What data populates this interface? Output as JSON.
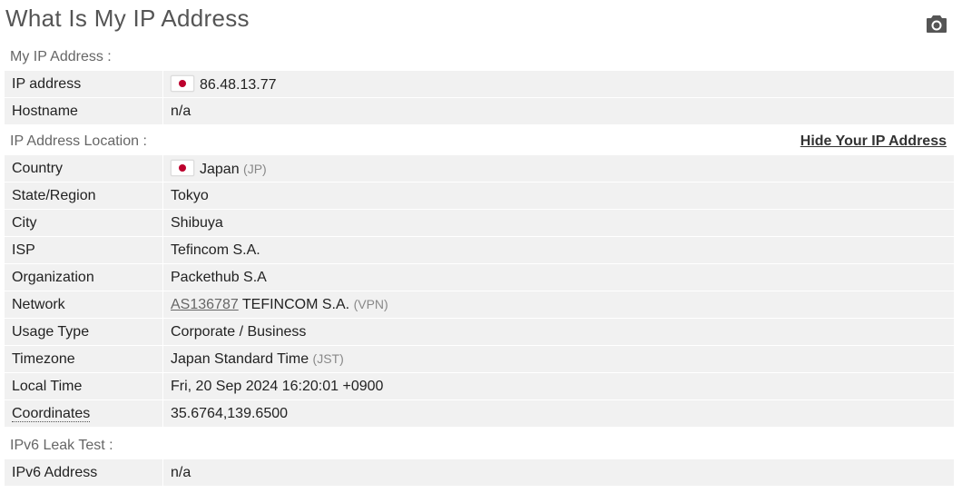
{
  "page": {
    "title": "What Is My IP Address",
    "camera_icon": "camera-icon"
  },
  "ip_section": {
    "label": "My IP Address :",
    "rows": [
      {
        "key": "IP address",
        "value": "86.48.13.77",
        "flag": "japan-flag-icon"
      },
      {
        "key": "Hostname",
        "value": "n/a"
      }
    ]
  },
  "location_section": {
    "label": "IP Address Location :",
    "hide_link": "Hide Your IP Address",
    "rows": [
      {
        "key": "Country",
        "value": "Japan",
        "extra": "(JP)",
        "flag": "japan-flag-icon"
      },
      {
        "key": "State/Region",
        "value": "Tokyo"
      },
      {
        "key": "City",
        "value": "Shibuya"
      },
      {
        "key": "ISP",
        "value": "Tefincom S.A."
      },
      {
        "key": "Organization",
        "value": "Packethub S.A"
      },
      {
        "key": "Network",
        "link": "AS136787",
        "value": "TEFINCOM S.A.",
        "extra": "(VPN)"
      },
      {
        "key": "Usage Type",
        "value": "Corporate / Business"
      },
      {
        "key": "Timezone",
        "value": "Japan Standard Time",
        "extra": "(JST)"
      },
      {
        "key": "Local Time",
        "value": "Fri, 20 Sep 2024 16:20:01 +0900"
      },
      {
        "key": "Coordinates",
        "value": "35.6764,139.6500"
      }
    ]
  },
  "ipv6_section": {
    "label": "IPv6 Leak Test :",
    "rows": [
      {
        "key": "IPv6 Address",
        "value": "n/a"
      }
    ]
  },
  "colors": {
    "row_bg": "#f1f1f1",
    "flag_red": "#bc002d",
    "title": "#555555"
  }
}
